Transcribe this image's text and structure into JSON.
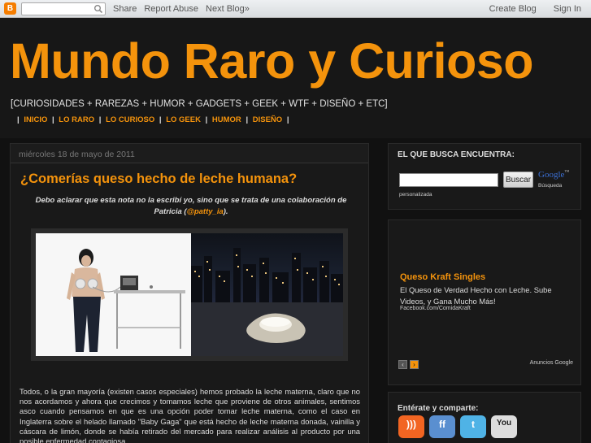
{
  "navbar": {
    "logo_text": "B",
    "links": [
      "Share",
      "Report Abuse",
      "Next Blog»"
    ],
    "create_blog": "Create Blog",
    "sign_in": "Sign In"
  },
  "header": {
    "title": "Mundo Raro y Curioso",
    "description": "[CURIOSIDADES + RAREZAS + HUMOR + GADGETS + GEEK + WTF + DISEÑO + ETC]",
    "nav": [
      "INICIO",
      "LO RARO",
      "LO CURIOSO",
      "LO GEEK",
      "HUMOR",
      "DISEÑO"
    ],
    "nav_separator": "|"
  },
  "post": {
    "date": "miércoles 18 de mayo de 2011",
    "title": "¿Comerías queso hecho de leche humana?",
    "intro_before": "Debo aclarar que esta nota no la escribí yo, sino que se trata de una colaboración de Patricia (",
    "intro_handle": "@patty_ia",
    "intro_after": ").",
    "body": "Todos, o la gran mayoría (existen casos especiales) hemos probado la leche materna, claro que no nos acordamos y ahora que crecimos y tomamos leche que proviene de otros animales, sentimos asco cuando pensamos en que es una opción poder tomar leche materna, como el caso en Inglaterra sobre el helado llamado \"Baby Gaga\" que está hecho de leche materna donada, vainilla y cáscara de limón, donde se había retirado del mercado para realizar análisis al producto por una posible enfermedad contagiosa."
  },
  "sidebar": {
    "search": {
      "title": "EL QUE BUSCA ENCUENTRA:",
      "button": "Buscar",
      "google": "Google",
      "google_sub": "Búsqueda",
      "personalizada": "personalizada"
    },
    "ad": {
      "title": "Queso Kraft Singles",
      "text": "El Queso de Verdad Hecho con Leche. Sube Videos, y Gana Mucho Más!",
      "url": "Facebook.com/ComidaKraft",
      "prev": "‹",
      "next": "›",
      "choice": "Anuncios Google"
    },
    "social": {
      "title": "Entérate y comparte:",
      "items": [
        {
          "name": "rss",
          "glyph": ")))",
          "color": "#f26522"
        },
        {
          "name": "friendfeed",
          "glyph": "ff",
          "color": "#5a8fd0"
        },
        {
          "name": "twitter",
          "glyph": "t",
          "color": "#4fb3e6"
        },
        {
          "name": "youtube",
          "glyph": "You",
          "color": "#dddddd"
        }
      ]
    }
  },
  "colors": {
    "accent": "#f4930c",
    "background": "#111111",
    "panel": "#191919"
  }
}
